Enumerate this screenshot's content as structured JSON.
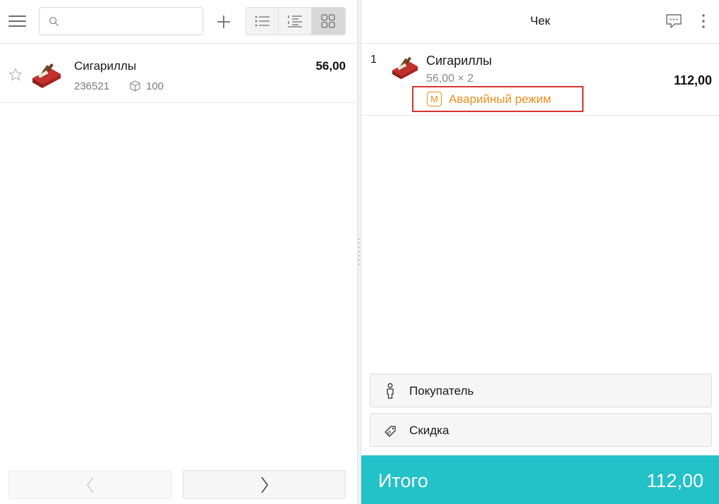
{
  "search": {
    "placeholder": "",
    "value": ""
  },
  "catalog": {
    "items": [
      {
        "name": "Сигариллы",
        "code": "236521",
        "stock": "100",
        "price": "56,00",
        "favorite": false
      }
    ]
  },
  "receipt": {
    "title": "Чек",
    "lines": [
      {
        "number": "1",
        "name": "Сигариллы",
        "qty_text": "56,00 × 2",
        "total": "112,00",
        "mode_badge": "Аварийный режим",
        "mode_icon_letter": "M"
      }
    ],
    "buyer_label": "Покупатель",
    "discount_label": "Скидка",
    "total_label": "Итого",
    "total_value": "112,00"
  },
  "colors": {
    "accent": "#23c1c8",
    "warning": "#e8901e",
    "highlight_border": "#d9322b"
  },
  "icons": {
    "menu": "hamburger-icon",
    "search": "search-icon",
    "add": "plus-icon",
    "view_list": "list-view-icon",
    "view_detailed": "numbered-list-view-icon",
    "view_grid": "grid-view-icon",
    "favorite": "star-icon",
    "stock": "box-icon",
    "comment": "chat-icon",
    "more": "more-vertical-icon",
    "buyer": "person-icon",
    "discount": "tag-icon",
    "prev": "chevron-left-icon",
    "next": "chevron-right-icon"
  }
}
